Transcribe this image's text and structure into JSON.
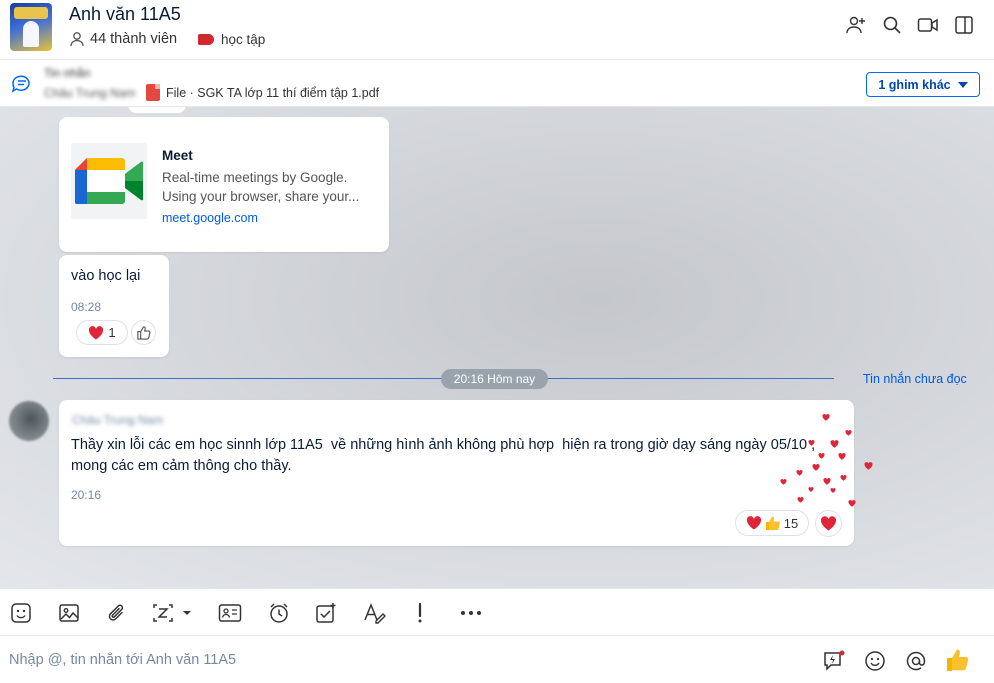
{
  "header": {
    "group_name": "Anh văn 11A5",
    "members": "44 thành viên",
    "tag": "học tập"
  },
  "pinned": {
    "title": "Tin nhắn",
    "sender": "Châu Trung Nam",
    "file": "File · SGK TA lớp 11 thí điểm tập 1.pdf",
    "more_label": "1 ghim khác"
  },
  "messages": [
    {
      "type": "link_card",
      "title": "Meet",
      "desc_line1": "Real-time meetings by Google.",
      "desc_line2": "Using your browser, share your...",
      "link": "meet.google.com"
    },
    {
      "type": "text",
      "text": "vào học lại",
      "time": "08:28",
      "reaction_count": "1"
    },
    {
      "type": "text",
      "sender": "Châu Trung Nam",
      "line1": "Thầy xin lỗi các em học sinnh lớp 11A5  về những hình ảnh không phù hợp  hiện ra trong giờ dạy sáng ngày 05/10 ,",
      "line2": "mong các em cảm thông cho thầy.",
      "time": "20:16",
      "reaction_count": "15"
    }
  ],
  "divider": {
    "time_label": "20:16 Hôm nay",
    "unread_label": "Tin nhắn chưa đọc"
  },
  "composer": {
    "placeholder": "Nhập @, tin nhắn tới Anh văn 11A5"
  },
  "colors": {
    "accent": "#0068ff",
    "link": "#005ae0",
    "heart": "#e0243a",
    "tag": "#d0282e"
  },
  "icons": [
    "add-member-icon",
    "search-icon",
    "video-call-icon",
    "sidebar-toggle-icon",
    "pinned-message-icon",
    "sticker-icon",
    "image-icon",
    "attachment-icon",
    "screenshot-icon",
    "business-card-icon",
    "reminder-icon",
    "task-icon",
    "text-format-icon",
    "urgent-icon",
    "more-icon",
    "quick-message-icon",
    "emoji-icon",
    "mention-icon",
    "like-icon"
  ]
}
